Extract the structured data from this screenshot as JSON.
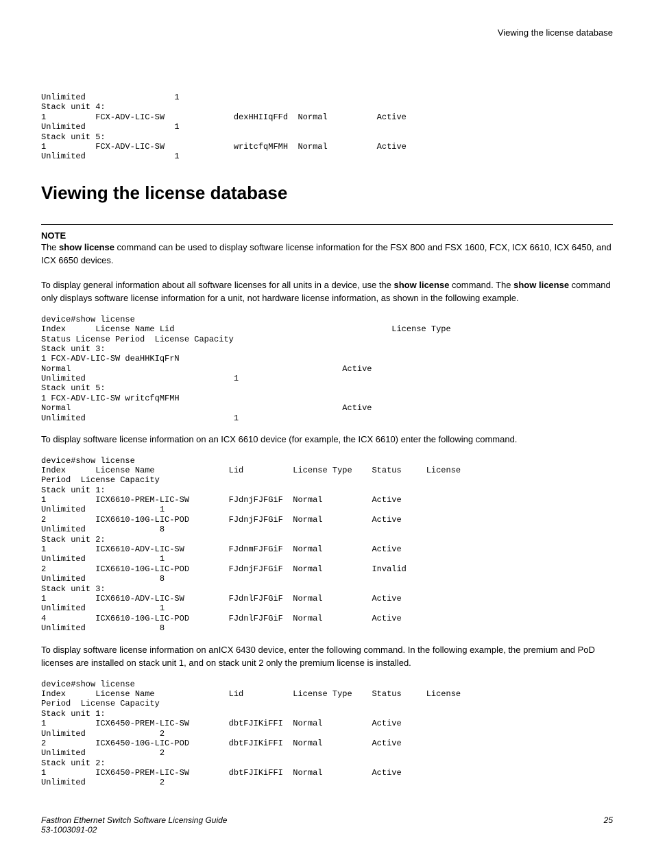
{
  "header": {
    "section_title": "Viewing the license database"
  },
  "pre1": "Unlimited                  1 \nStack unit 4:\n1          FCX-ADV-LIC-SW              dexHHIIqFFd  Normal          Active        \nUnlimited                  1 \nStack unit 5:\n1          FCX-ADV-LIC-SW              writcfqMFMH  Normal          Active        \nUnlimited                  1 ",
  "heading": "Viewing the license database",
  "note": {
    "label": "NOTE",
    "text_before_bold": "The ",
    "bold1": "show license",
    "text_after_bold": " command can be used to display software license information for the FSX 800 and FSX 1600, FCX, ICX 6610, ICX 6450, and ICX 6650 devices."
  },
  "para1": {
    "t1": "To display general information about all software licenses for all units in a device, use the ",
    "b1": "show license",
    "t2": " command. The ",
    "b2": "show license",
    "t3": " command only displays software license information for a unit, not hardware license information, as shown in the following example."
  },
  "pre2": "device#show license\nIndex      License Name Lid                                            License Type    \nStatus License Period  License Capacity \nStack unit 3:\n1 FCX-ADV-LIC-SW deaHHKIqFrN                                            \nNormal                                                       Active        \nUnlimited                              1 \nStack unit 5:\n1 FCX-ADV-LIC-SW writcfqMFMH                                            \nNormal                                                       Active        \nUnlimited                              1 ",
  "para2": "To display software license information on an ICX 6610 device (for example, the ICX 6610) enter the following command.",
  "pre3": "device#show license\nIndex      License Name               Lid          License Type    Status     License \nPeriod  License Capacity \nStack unit 1:\n1          ICX6610-PREM-LIC-SW        FJdnjFJFGiF  Normal          Active        \nUnlimited               1 \n2          ICX6610-10G-LIC-POD        FJdnjFJFGiF  Normal          Active        \nUnlimited               8 \nStack unit 2:\n1          ICX6610-ADV-LIC-SW         FJdnmFJFGiF  Normal          Active        \nUnlimited               1 \n2          ICX6610-10G-LIC-POD        FJdnjFJFGiF  Normal          Invalid       \nUnlimited               8 \nStack unit 3:\n1          ICX6610-ADV-LIC-SW         FJdnlFJFGiF  Normal          Active        \nUnlimited               1 \n4          ICX6610-10G-LIC-POD        FJdnlFJFGiF  Normal          Active        \nUnlimited               8 ",
  "para3": "To display software license information on anICX 6430 device, enter the following command. In the following example, the premium and PoD licenses are installed on stack unit 1, and on stack unit 2 only the premium license is installed.",
  "pre4": "device#show license\nIndex      License Name               Lid          License Type    Status     License \nPeriod  License Capacity \nStack unit 1:\n1          ICX6450-PREM-LIC-SW        dbtFJIKiFFI  Normal          Active        \nUnlimited               2 \n2          ICX6450-10G-LIC-POD        dbtFJIKiFFI  Normal          Active        \nUnlimited               2 \nStack unit 2:\n1          ICX6450-PREM-LIC-SW        dbtFJIKiFFI  Normal          Active        \nUnlimited               2 ",
  "footer": {
    "line1": "FastIron Ethernet Switch Software Licensing Guide",
    "line2": "53-1003091-02",
    "page": "25"
  }
}
